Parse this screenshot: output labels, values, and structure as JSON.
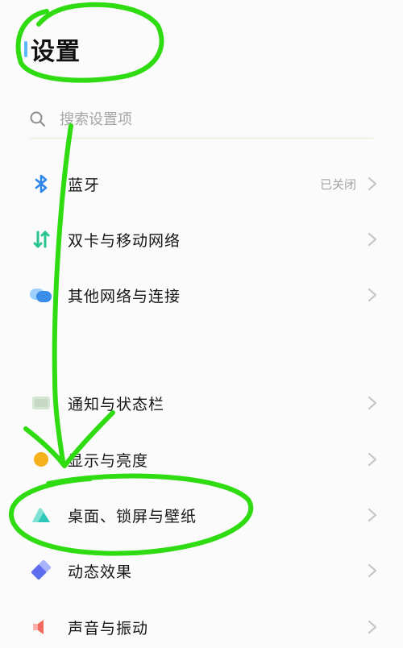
{
  "header": {
    "title": "设置"
  },
  "search": {
    "placeholder": "搜索设置项"
  },
  "items": [
    {
      "label": "蓝牙",
      "value": "已关闭",
      "icon": "bluetooth-icon"
    },
    {
      "label": "双卡与移动网络",
      "icon": "dual-sim-icon"
    },
    {
      "label": "其他网络与连接",
      "icon": "network-connection-icon"
    },
    {
      "label": "通知与状态栏",
      "icon": "notification-icon"
    },
    {
      "label": "显示与亮度",
      "icon": "display-brightness-icon"
    },
    {
      "label": "桌面、锁屏与壁纸",
      "icon": "wallpaper-icon"
    },
    {
      "label": "动态效果",
      "icon": "dynamic-effects-icon"
    },
    {
      "label": "声音与振动",
      "icon": "sound-icon"
    }
  ],
  "colors": {
    "annotation": "#2fdc11",
    "bluetooth": "#2f86e8",
    "dual_sim": "#28c48f",
    "network": "#4a9ff0",
    "display": "#f6b21c",
    "wallpaper": "#2cc7b8",
    "dynamic": "#6f7cf2",
    "sound": "#f06b5d"
  }
}
